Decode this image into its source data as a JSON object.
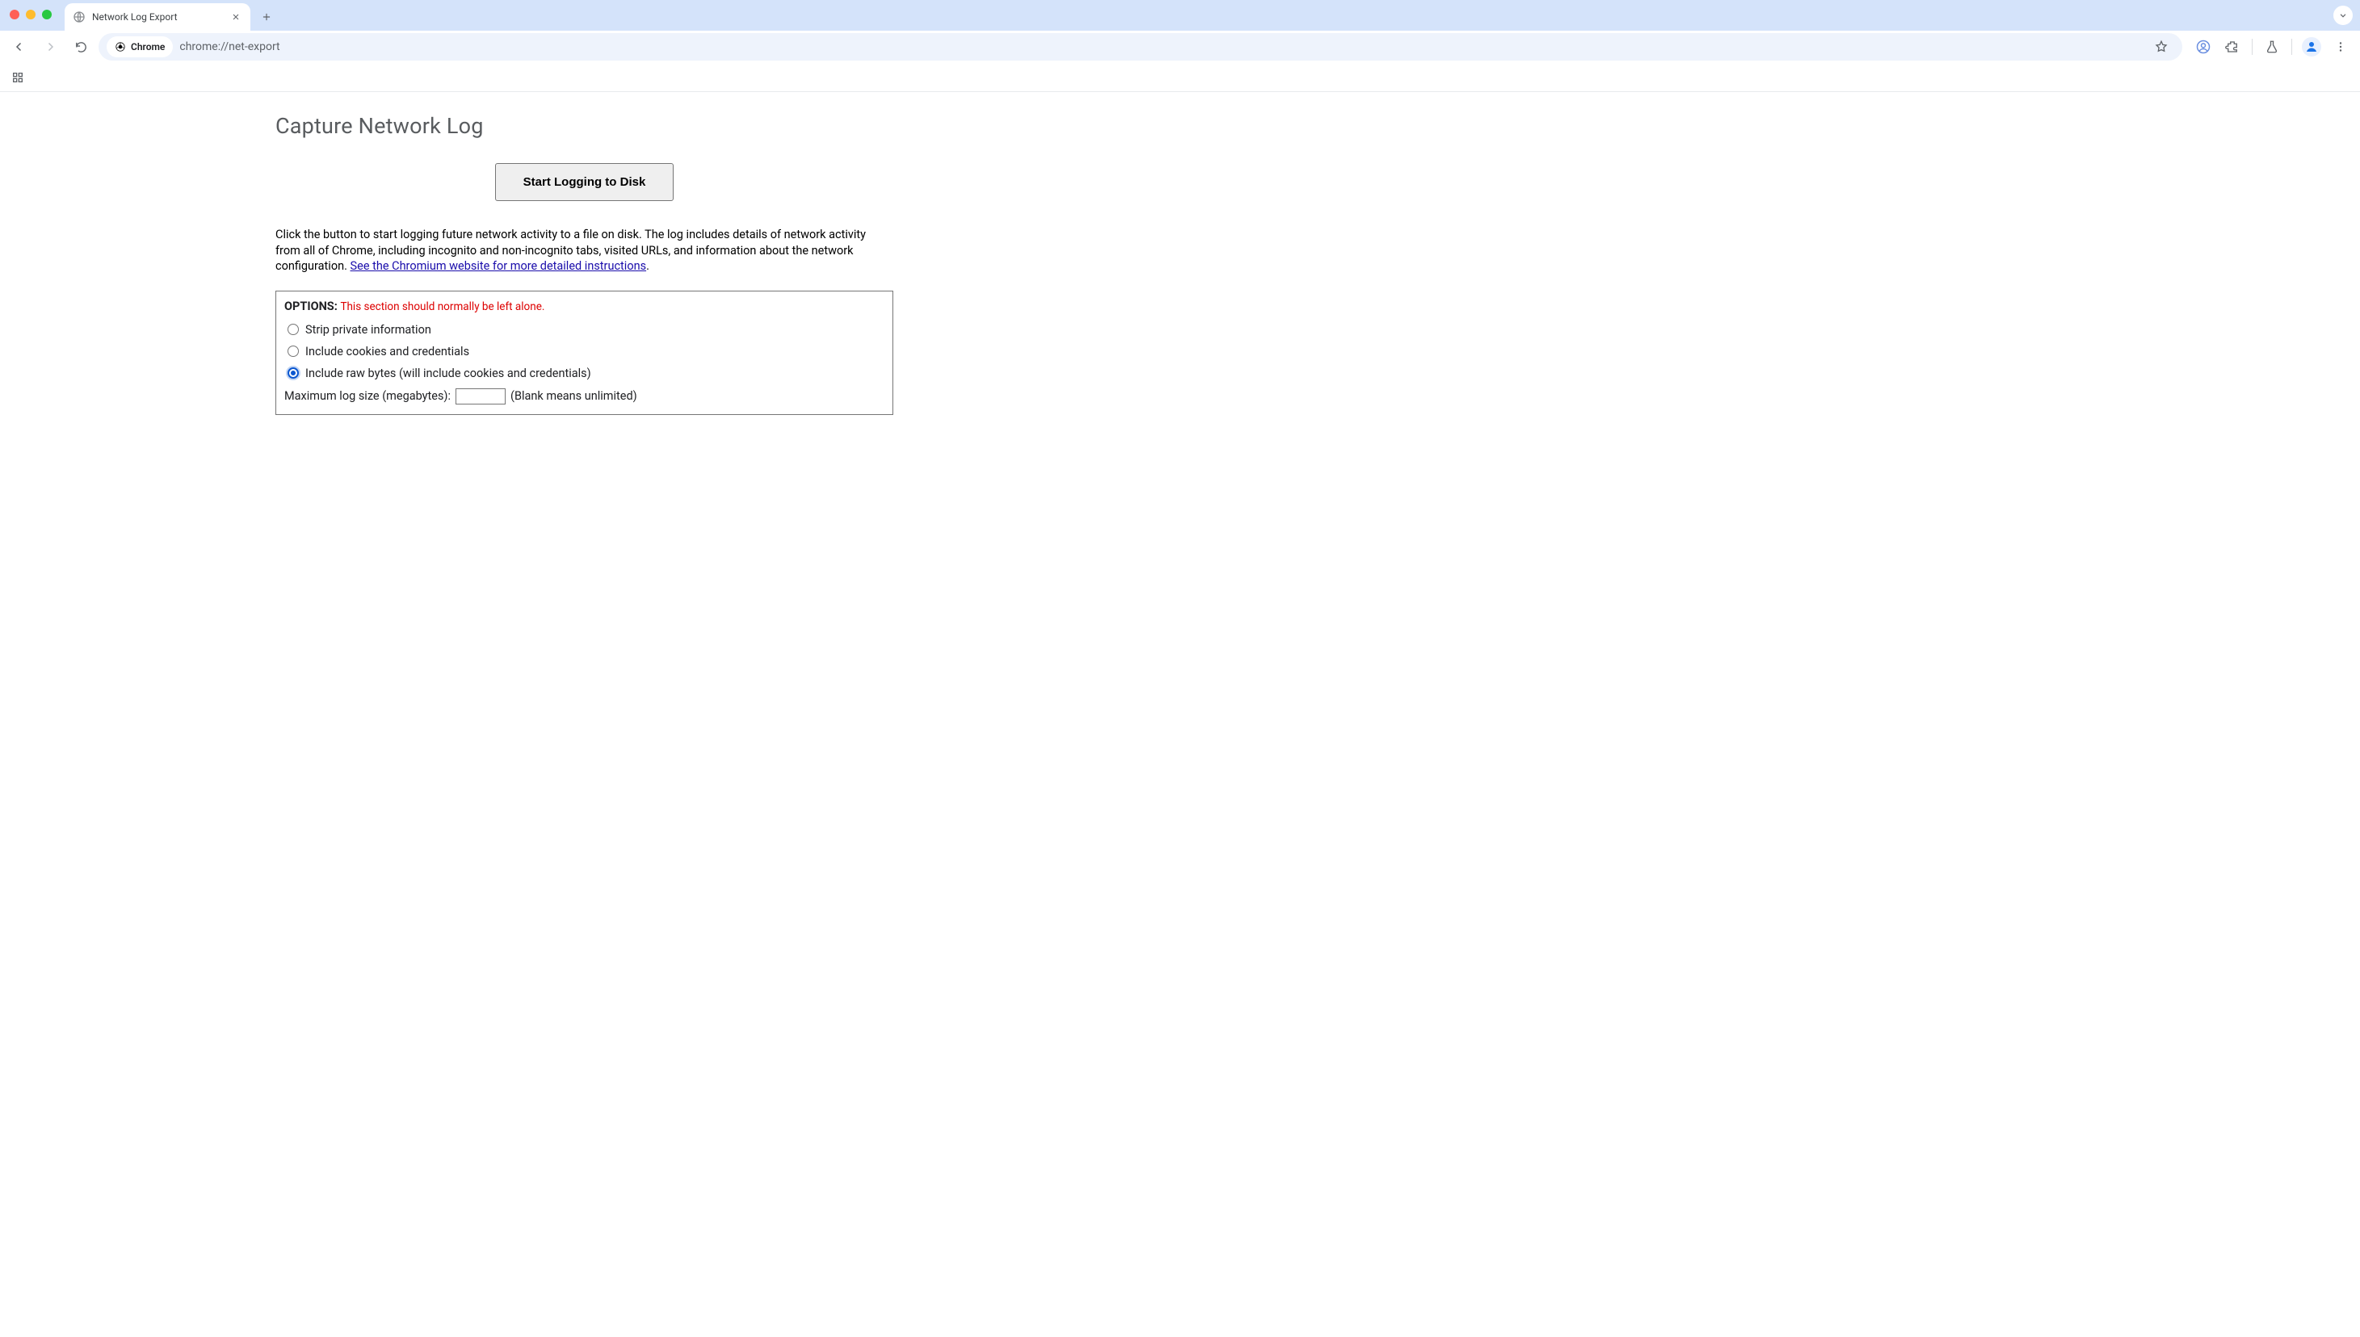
{
  "browser": {
    "tab_title": "Network Log Export",
    "chip_label": "Chrome",
    "url": "chrome://net-export"
  },
  "page": {
    "title": "Capture Network Log",
    "start_button": "Start Logging to Disk",
    "description_prefix": "Click the button to start logging future network activity to a file on disk. The log includes details of network activity from all of Chrome, including incognito and non-incognito tabs, visited URLs, and information about the network configuration. ",
    "description_link": "See the Chromium website for more detailed instructions",
    "description_suffix": ".",
    "options": {
      "heading": "OPTIONS",
      "heading_colon": ": ",
      "warning": "This section should normally be left alone.",
      "radios": [
        {
          "label": "Strip private information",
          "checked": false
        },
        {
          "label": "Include cookies and credentials",
          "checked": false
        },
        {
          "label": "Include raw bytes (will include cookies and credentials)",
          "checked": true
        }
      ],
      "max_label": "Maximum log size (megabytes): ",
      "max_value": "",
      "max_hint": "(Blank means unlimited)"
    }
  }
}
